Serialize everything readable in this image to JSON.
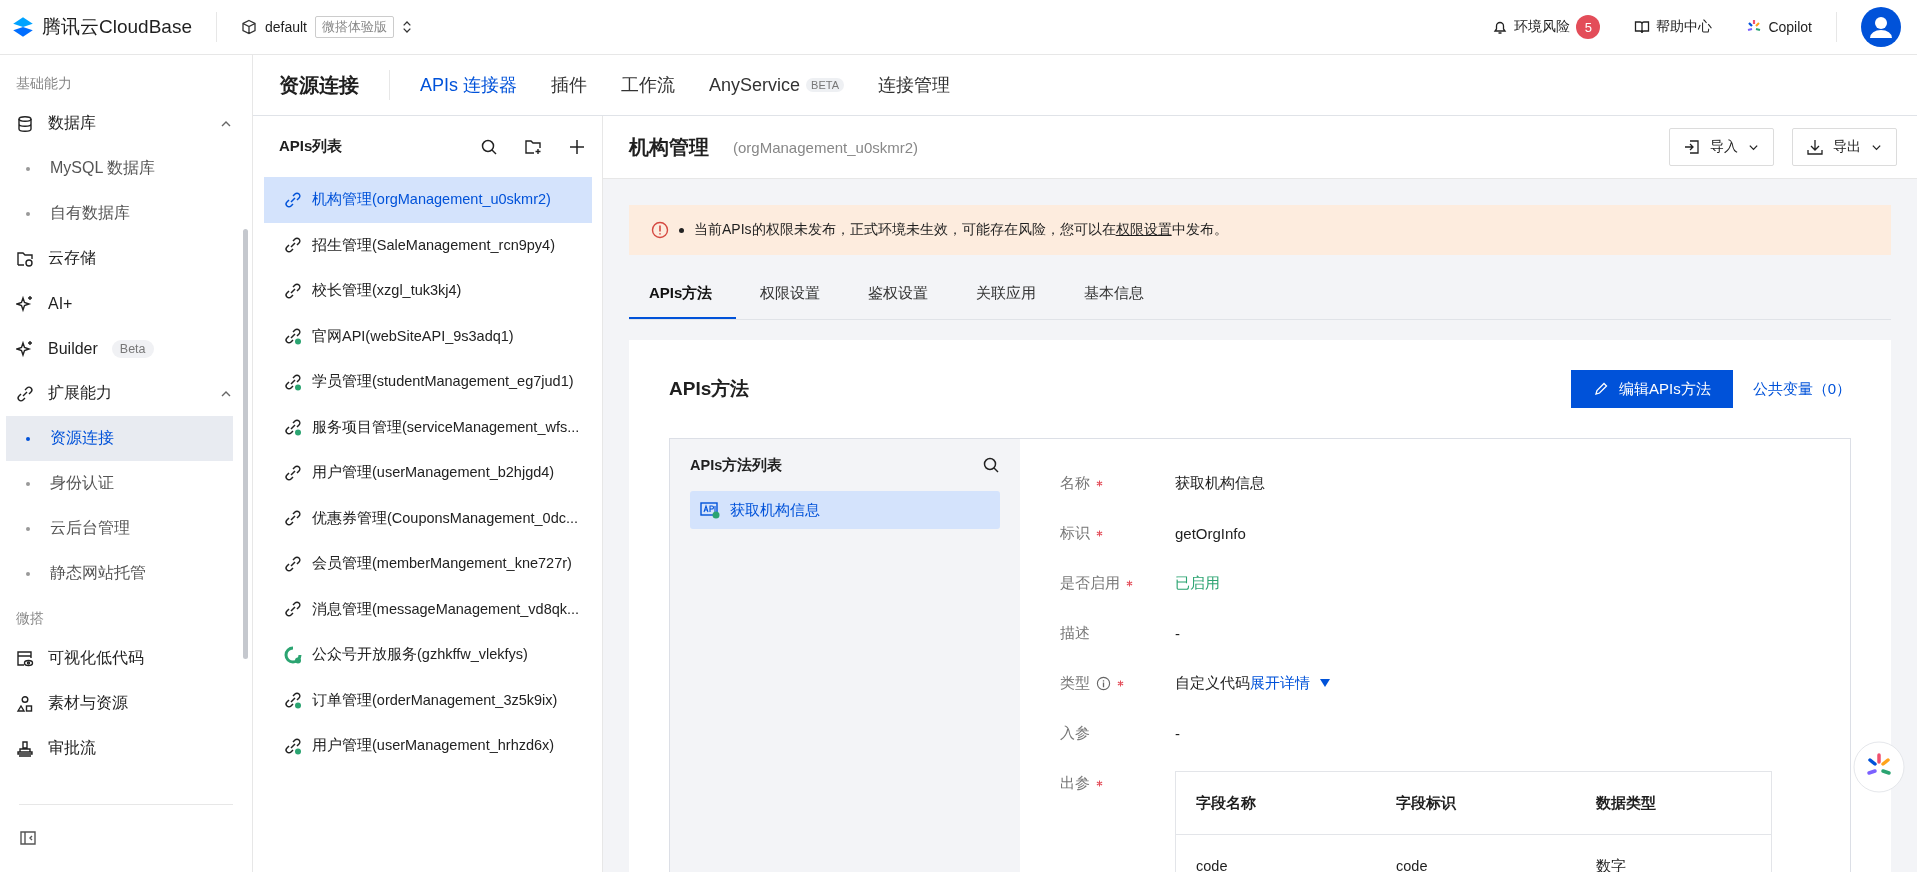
{
  "topbar": {
    "brand": "腾讯云CloudBase",
    "env": "default",
    "env_badge": "微搭体验版",
    "risk": "环境风险",
    "risk_count": "5",
    "help": "帮助中心",
    "copilot": "Copilot"
  },
  "sidebar": {
    "items": [
      {
        "kind": "section",
        "label": "基础能力"
      },
      {
        "kind": "group",
        "label": "数据库",
        "expanded": true
      },
      {
        "kind": "sub",
        "label": "MySQL 数据库",
        "selected": false
      },
      {
        "kind": "sub",
        "label": "自有数据库",
        "selected": false
      },
      {
        "kind": "item",
        "label": "云存储"
      },
      {
        "kind": "item",
        "label": "AI+"
      },
      {
        "kind": "item",
        "label": "Builder",
        "badge": "Beta"
      },
      {
        "kind": "group",
        "label": "扩展能力",
        "expanded": true
      },
      {
        "kind": "sub",
        "label": "资源连接",
        "selected": true
      },
      {
        "kind": "sub",
        "label": "身份认证",
        "selected": false
      },
      {
        "kind": "sub",
        "label": "云后台管理",
        "selected": false
      },
      {
        "kind": "sub",
        "label": "静态网站托管",
        "selected": false
      },
      {
        "kind": "section",
        "label": "微搭"
      },
      {
        "kind": "item",
        "label": "可视化低代码"
      },
      {
        "kind": "item",
        "label": "素材与资源"
      },
      {
        "kind": "item",
        "label": "审批流"
      }
    ]
  },
  "page": {
    "title": "资源连接",
    "tabs": [
      {
        "label": "APIs 连接器",
        "selected": true
      },
      {
        "label": "插件",
        "selected": false
      },
      {
        "label": "工作流",
        "selected": false
      },
      {
        "label": "AnyService",
        "badge": "BETA",
        "selected": false
      },
      {
        "label": "连接管理",
        "selected": false
      }
    ]
  },
  "api_list": {
    "title": "APIs列表",
    "items": [
      {
        "kind": "link",
        "label": "机构管理(orgManagement_u0skmr2)",
        "selected": true
      },
      {
        "kind": "link",
        "label": "招生管理(SaleManagement_rcn9py4)",
        "selected": false
      },
      {
        "kind": "link",
        "label": "校长管理(xzgl_tuk3kj4)",
        "selected": false
      },
      {
        "kind": "link-check",
        "label": "官网API(webSiteAPI_9s3adq1)",
        "selected": false
      },
      {
        "kind": "link-check",
        "label": "学员管理(studentManagement_eg7jud1)",
        "selected": false
      },
      {
        "kind": "link-check",
        "label": "服务项目管理(serviceManagement_wfs...",
        "selected": false
      },
      {
        "kind": "link",
        "label": "用户管理(userManagement_b2hjgd4)",
        "selected": false
      },
      {
        "kind": "link",
        "label": "优惠券管理(CouponsManagement_0dc...",
        "selected": false
      },
      {
        "kind": "link",
        "label": "会员管理(memberMangement_kne727r)",
        "selected": false
      },
      {
        "kind": "link",
        "label": "消息管理(messageManagement_vd8qk...",
        "selected": false
      },
      {
        "kind": "recycle",
        "label": "公众号开放服务(gzhkffw_vlekfys)",
        "selected": false
      },
      {
        "kind": "link-check",
        "label": "订单管理(orderManagement_3z5k9ix)",
        "selected": false
      },
      {
        "kind": "link-check",
        "label": "用户管理(userManagement_hrhzd6x)",
        "selected": false
      }
    ]
  },
  "detail": {
    "title": "机构管理",
    "subtitle": "(orgManagement_u0skmr2)",
    "import": "导入",
    "export": "导出",
    "alert": "当前APIs的权限未发布，正式环境未生效，可能存在风险，您可以在**权限设置**中发布。",
    "tabs": [
      {
        "label": "APIs方法",
        "selected": true
      },
      {
        "label": "权限设置",
        "selected": false
      },
      {
        "label": "鉴权设置",
        "selected": false
      },
      {
        "label": "关联应用",
        "selected": false
      },
      {
        "label": "基本信息",
        "selected": false
      }
    ],
    "card_title": "APIs方法",
    "edit_button": "编辑APIs方法",
    "vars_link": "公共变量（0）",
    "method_list": {
      "title": "APIs方法列表",
      "items": [
        {
          "label": "获取机构信息",
          "selected": true
        }
      ]
    },
    "fields": [
      {
        "kind": "text",
        "label": "名称",
        "required": true,
        "value": "获取机构信息"
      },
      {
        "kind": "text",
        "label": "标识",
        "required": true,
        "value": "getOrgInfo"
      },
      {
        "kind": "status",
        "label": "是否启用",
        "required": true,
        "value": "已启用"
      },
      {
        "kind": "text",
        "label": "描述",
        "required": false,
        "value": "-"
      },
      {
        "kind": "type",
        "label": "类型",
        "required": true,
        "value": "自定义代码",
        "link": "展开详情"
      },
      {
        "kind": "text",
        "label": "入参",
        "required": false,
        "value": "-"
      },
      {
        "kind": "table",
        "label": "出参",
        "required": true
      }
    ],
    "table": {
      "columns": [
        "字段名称",
        "字段标识",
        "数据类型"
      ],
      "rows": [
        [
          "code",
          "code",
          "数字"
        ]
      ]
    }
  }
}
